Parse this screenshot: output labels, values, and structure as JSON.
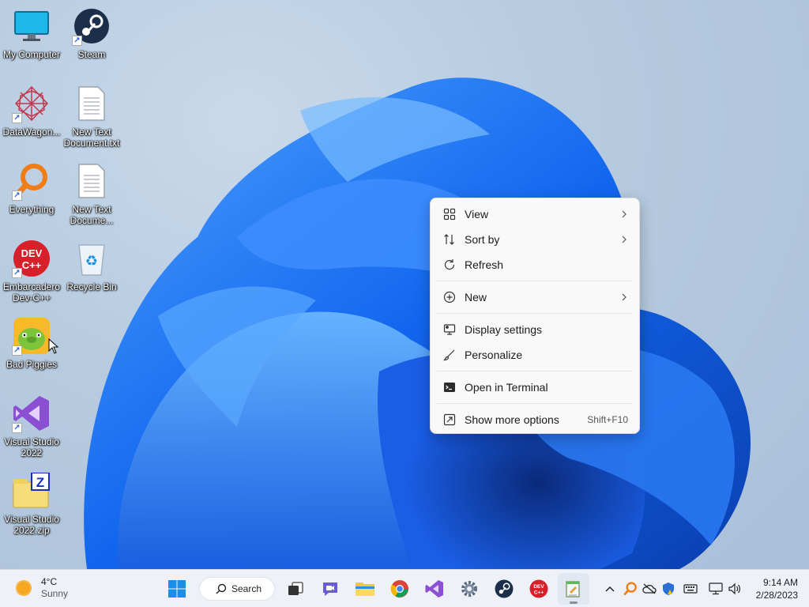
{
  "desktop": {
    "icons": [
      {
        "label": "My Computer",
        "icon": "monitor-icon"
      },
      {
        "label": "Steam",
        "icon": "steam-icon"
      },
      {
        "label": "DataWagon...",
        "icon": "datawagon-icon"
      },
      {
        "label": "New Text Document.txt",
        "icon": "text-file-icon"
      },
      {
        "label": "Everything",
        "icon": "everything-search-icon"
      },
      {
        "label": "New Text Docume...",
        "icon": "text-file-icon"
      },
      {
        "label": "Embarcadero Dev-C++",
        "icon": "devcpp-icon"
      },
      {
        "label": "Recycle Bin",
        "icon": "recycle-bin-icon"
      },
      {
        "label": "Bad Piggies",
        "icon": "bad-piggies-icon"
      },
      {
        "label": "Visual Studio 2022",
        "icon": "visual-studio-icon"
      },
      {
        "label": "Visual Studio 2022.zip",
        "icon": "zip-archive-icon"
      }
    ]
  },
  "context_menu": {
    "items": [
      {
        "label": "View",
        "icon": "grid-icon",
        "submenu": true
      },
      {
        "label": "Sort by",
        "icon": "sort-icon",
        "submenu": true
      },
      {
        "label": "Refresh",
        "icon": "refresh-icon",
        "submenu": false
      },
      {
        "label": "New",
        "icon": "plus-circle-icon",
        "submenu": true
      },
      {
        "label": "Display settings",
        "icon": "display-icon",
        "submenu": false
      },
      {
        "label": "Personalize",
        "icon": "brush-icon",
        "submenu": false
      },
      {
        "label": "Open in Terminal",
        "icon": "terminal-icon",
        "submenu": false
      },
      {
        "label": "Show more options",
        "icon": "more-options-icon",
        "submenu": false,
        "accelerator": "Shift+F10"
      }
    ]
  },
  "taskbar": {
    "weather": {
      "temp": "4°C",
      "condition": "Sunny"
    },
    "search_label": "Search",
    "apps": [
      "start-icon",
      "search-icon",
      "task-view-icon",
      "teams-chat-icon",
      "file-explorer-icon",
      "chrome-icon",
      "visual-studio-icon",
      "settings-icon",
      "steam-icon",
      "devcpp-icon",
      "notepad-icon"
    ],
    "tray": [
      "chevron-up-icon",
      "everything-search-icon",
      "onedrive-icon",
      "defender-icon",
      "keyboard-icon",
      "network-icon",
      "volume-icon"
    ],
    "clock": {
      "time": "9:14 AM",
      "date": "2/28/2023"
    }
  },
  "colors": {
    "accent": "#0067c0",
    "wallpaper_bloom": "#1a6cf0",
    "menu_bg": "#f9f9f9",
    "taskbar_bg": "#eef2f8"
  }
}
